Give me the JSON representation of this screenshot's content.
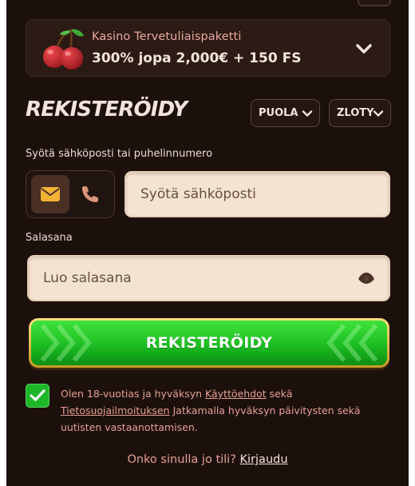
{
  "bonus": {
    "title": "Kasino Tervetuliaispaketti",
    "offer": "300% jopa 2,000€ + 150 FS"
  },
  "form": {
    "heading": "REKISTERÖIDY",
    "language": "PUOLA",
    "currency": "ZLOTY",
    "email_label": "Syötä sähköposti tai puhelinnumero",
    "email_placeholder": "Syötä sähköposti",
    "password_label": "Salasana",
    "password_placeholder": "Luo salasana",
    "submit_label": "REKISTERÖIDY",
    "email_toggle_active": "email"
  },
  "terms": {
    "checked": true,
    "text_1": "Olen 18-vuotias ja hyväksyn",
    "link_terms": "Käyttöehdot",
    "text_2": "sekä",
    "link_privacy": "Tietosuojailmoituksen",
    "text_3": "Jatkamalla hyväksyn päivitysten sekä uutisten vastaanottamisen."
  },
  "login": {
    "prompt": "Onko sinulla jo tili?",
    "link": "Kirjaudu"
  },
  "colors": {
    "panel_bg": "#1c100c",
    "accent_green": "#1fb72a",
    "accent_gold": "#f3c63a",
    "input_bg": "#f4e3d0",
    "link_salmon": "#e69f92"
  },
  "icons": {
    "bonus": "cherry-icon",
    "expand": "chevron-down-icon",
    "email": "envelope-icon",
    "phone": "phone-icon",
    "password_toggle": "eye-icon",
    "checkbox": "checkmark-icon"
  }
}
